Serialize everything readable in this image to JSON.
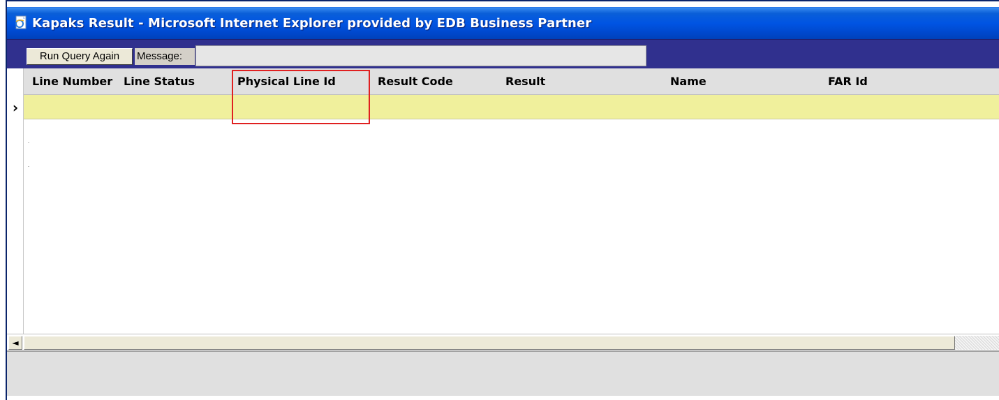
{
  "window": {
    "title": "Kapaks Result - Microsoft Internet Explorer provided by EDB Business Partner",
    "icon": "ie-page-icon"
  },
  "toolbar": {
    "run_query_label": "Run Query Again",
    "message_label": "Message:",
    "message_value": ""
  },
  "grid": {
    "columns": [
      "Line Number",
      "Line Status",
      "Physical Line Id",
      "Result Code",
      "Result",
      "Name",
      "FAR Id"
    ],
    "current_row_indicator": "›",
    "row_highlight_color": "#f0f09c",
    "highlighted_column": "Physical Line Id",
    "highlight_color": "#e02020"
  },
  "scrollbar": {
    "left_arrow": "◄"
  }
}
